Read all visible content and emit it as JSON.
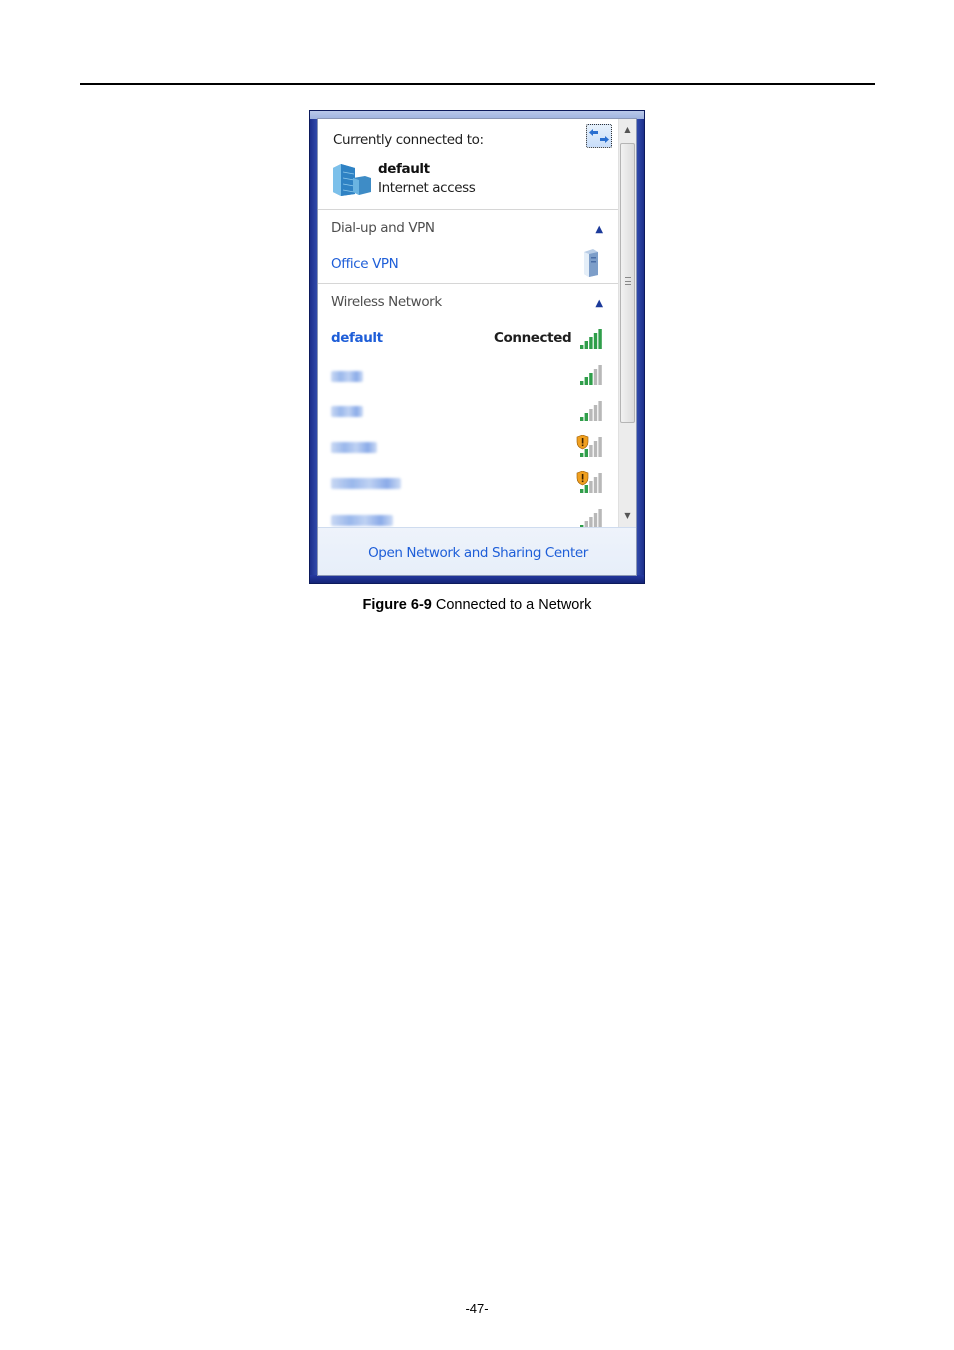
{
  "page": {
    "caption_label": "Figure 6-9",
    "caption_text": " Connected to a Network",
    "page_number": "-47-"
  },
  "network_flyout": {
    "connected_header": "Currently connected to:",
    "refresh_icon": "refresh-arrows-icon",
    "current_connection": {
      "name": "default",
      "status": "Internet access",
      "icon": "network-buildings-icon"
    },
    "sections": [
      {
        "title": "Dial-up and VPN",
        "collapse_icon": "chevron-up-icon",
        "items": [
          {
            "name": "Office VPN",
            "icon": "vpn-server-icon"
          }
        ]
      },
      {
        "title": "Wireless Network",
        "collapse_icon": "chevron-up-icon",
        "items": [
          {
            "name": "default",
            "status": "Connected",
            "signal_bars": 5,
            "secured_warning": false,
            "name_obscured": false
          },
          {
            "name": "",
            "status": "",
            "signal_bars": 3,
            "secured_warning": false,
            "name_obscured": true
          },
          {
            "name": "",
            "status": "",
            "signal_bars": 2,
            "secured_warning": false,
            "name_obscured": true
          },
          {
            "name": "",
            "status": "",
            "signal_bars": 2,
            "secured_warning": true,
            "name_obscured": true
          },
          {
            "name": "",
            "status": "",
            "signal_bars": 2,
            "secured_warning": true,
            "name_obscured": true
          },
          {
            "name": "",
            "status": "",
            "signal_bars": 1,
            "secured_warning": false,
            "name_obscured": true
          }
        ]
      }
    ],
    "footer_link": "Open Network and Sharing Center",
    "colors": {
      "link_blue": "#1e5ed8",
      "signal_green": "#2f9e4a",
      "signal_grey": "#b8b8b8",
      "warning_shield": "#f0a020",
      "frame_blue": "#1c2f8c"
    }
  }
}
